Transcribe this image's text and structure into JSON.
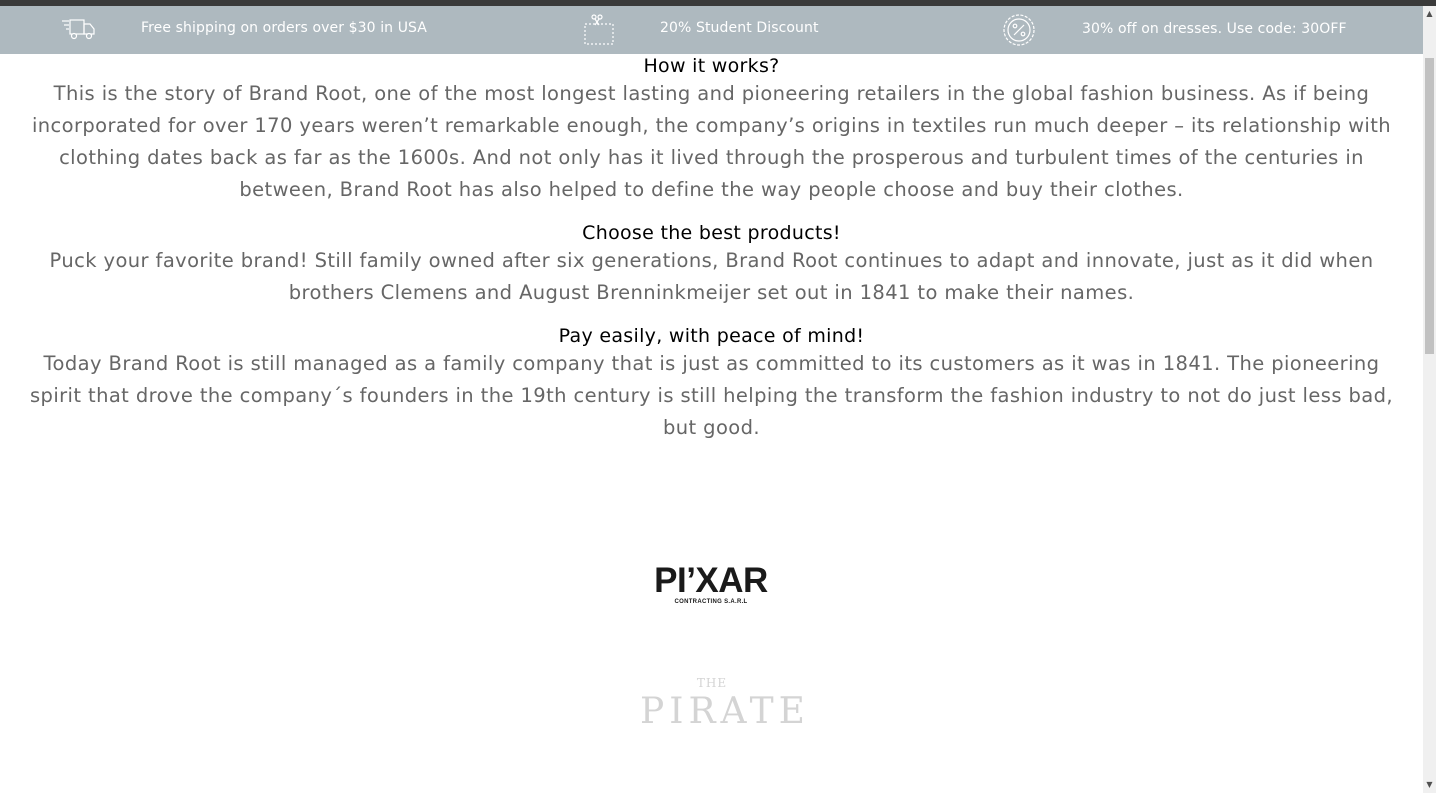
{
  "promo_bar": {
    "items": [
      {
        "icon": "delivery-truck-icon",
        "text": "Free shipping on orders over $30 in USA"
      },
      {
        "icon": "coupon-scissors-icon",
        "text": "20% Student Discount"
      },
      {
        "icon": "percent-badge-icon",
        "text": "30% off on dresses. Use code: 30OFF"
      }
    ],
    "background": "#aeb9bf",
    "text_color": "#ffffff"
  },
  "sections": [
    {
      "title": "How it works?",
      "body": "This is the story of Brand Root, one of the most longest lasting and pioneering retailers in the global fashion business. As if being incorporated for over 170 years weren’t remarkable enough, the company’s origins in textiles run much deeper – its relationship with clothing dates back as far as the 1600s. And not only has it lived through the prosperous and turbulent times of the centuries in between, Brand Root has also helped to define the way people choose and buy their clothes."
    },
    {
      "title": "Choose the best products!",
      "body": "Puck your favorite brand! Still family owned after six generations, Brand Root continues to adapt and innovate, just as it did when brothers Clemens and August Brenninkmeijer set out in 1841 to make their names."
    },
    {
      "title": "Pay easily, with peace of mind!",
      "body": "Today Brand Root is still managed as a family company that is just as committed to its customers as it was in 1841. The pioneering spirit that drove the company´s founders in the 19th century is still helping the transform the fashion industry to not do just less bad, but good."
    }
  ],
  "brand_logos": [
    {
      "mark": "PI’XAR",
      "subtitle": "CONTRACTING S.A.R.L"
    },
    {
      "mark_small": "THE",
      "mark": "PIRATE"
    }
  ],
  "colors": {
    "title": "#000000",
    "body_text": "#666666",
    "logo_dark": "#1a1a1a",
    "logo_light": "#d4d4d4"
  }
}
